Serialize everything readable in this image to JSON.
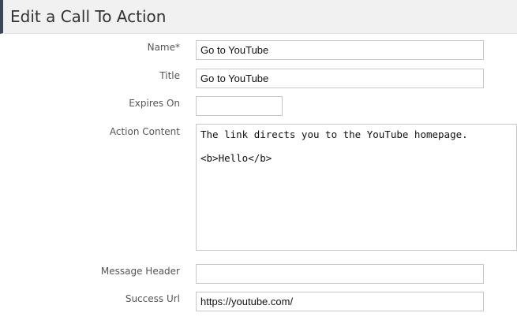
{
  "header": {
    "title": "Edit a Call To Action"
  },
  "form": {
    "name": {
      "label": "Name*",
      "value": "Go to YouTube"
    },
    "title": {
      "label": "Title",
      "value": "Go to YouTube"
    },
    "expires_on": {
      "label": "Expires On",
      "value": ""
    },
    "action_content": {
      "label": "Action Content",
      "value": "The link directs you to the YouTube homepage.\n\n<b>Hello</b>"
    },
    "message_header": {
      "label": "Message Header",
      "value": ""
    },
    "success_url": {
      "label": "Success Url",
      "value": "https://youtube.com/"
    }
  }
}
